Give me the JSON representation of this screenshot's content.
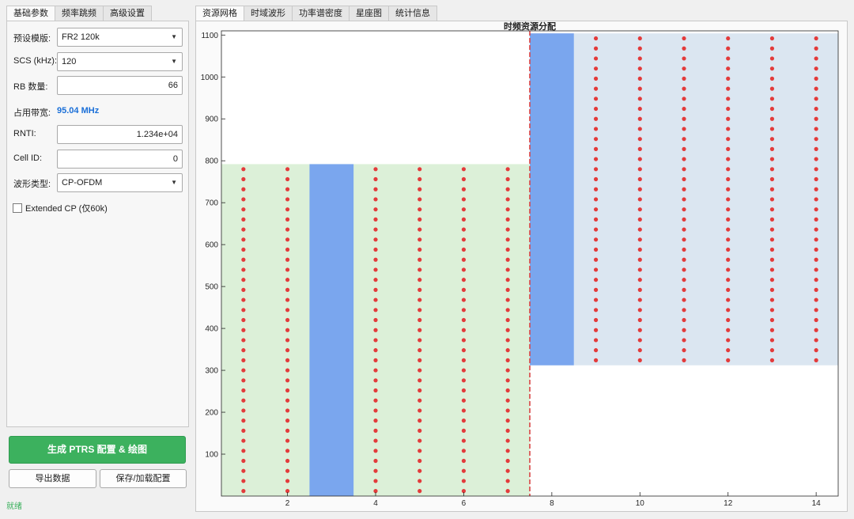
{
  "left_tabs": [
    "基础参数",
    "频率跳频",
    "高级设置"
  ],
  "form": {
    "preset_label": "预设模版:",
    "preset_value": "FR2 120k",
    "scs_label": "SCS (kHz):",
    "scs_value": "120",
    "rb_label": "RB 数量:",
    "rb_value": "66",
    "bw_label": "占用带宽:",
    "bw_value": "95.04 MHz",
    "rnti_label": "RNTI:",
    "rnti_value": "1.234e+04",
    "cellid_label": "Cell ID:",
    "cellid_value": "0",
    "waveform_label": "波形类型:",
    "waveform_value": "CP-OFDM",
    "extcp_label": "Extended CP (仅60k)",
    "extcp_checked": false
  },
  "buttons": {
    "generate": "生成 PTRS 配置 & 绘图",
    "export": "导出数据",
    "save_load": "保存/加载配置"
  },
  "status": "就绪",
  "right_tabs": [
    "资源网格",
    "时域波形",
    "功率谱密度",
    "星座图",
    "统计信息"
  ],
  "icons": {
    "dropdown": "chevron-down-icon",
    "checkbox": "checkbox-icon"
  },
  "colors": {
    "accent_green": "#3cb15e",
    "bw_blue": "#1a6fd8",
    "region1_fill": "#dcf0d8",
    "region2_fill": "#dbe6f1",
    "dmrs_fill": "#7aa6ee",
    "ptrs_dot": "#e33b3b",
    "hop_line": "#d94444"
  },
  "chart_data": {
    "type": "heatmap",
    "title": "时频资源分配",
    "xlim": [
      0.5,
      14.5
    ],
    "ylim": [
      0,
      1110
    ],
    "x_ticks": [
      2,
      4,
      6,
      8,
      10,
      12,
      14
    ],
    "y_ticks": [
      100,
      200,
      300,
      400,
      500,
      600,
      700,
      800,
      900,
      1000,
      1100
    ],
    "regions": [
      {
        "x": [
          0.5,
          7.5
        ],
        "y": [
          0,
          792
        ],
        "color": "#dcf0d8"
      },
      {
        "x": [
          7.5,
          14.5
        ],
        "y": [
          312,
          1104
        ],
        "color": "#dbe6f1"
      }
    ],
    "dmrs_columns": [
      {
        "symbol": 3,
        "y": [
          0,
          792
        ]
      },
      {
        "symbol": 8,
        "y": [
          312,
          1104
        ]
      }
    ],
    "ptrs": [
      {
        "symbols": [
          1,
          2,
          4,
          5,
          6,
          7
        ],
        "y": [
          0,
          792
        ],
        "spacing": 24
      },
      {
        "symbols": [
          9,
          10,
          11,
          12,
          13,
          14
        ],
        "y": [
          312,
          1104
        ],
        "spacing": 24
      }
    ],
    "hop_line_x": 7.5,
    "grid": false
  }
}
